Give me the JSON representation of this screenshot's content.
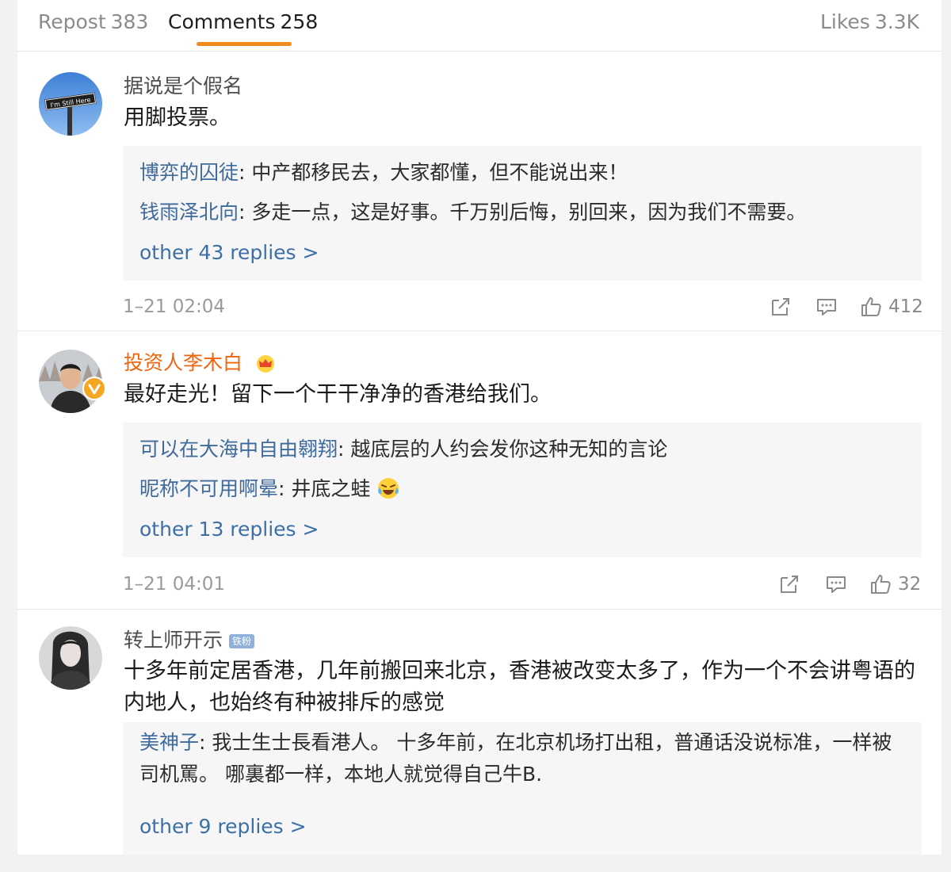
{
  "tabs": {
    "repost": {
      "label": "Repost",
      "count": "383"
    },
    "comments": {
      "label": "Comments",
      "count": "258"
    },
    "likes": {
      "label": "Likes",
      "count": "3.3K"
    }
  },
  "colors": {
    "accent": "#f28a1c",
    "link": "#3f6a9c",
    "vip_name": "#f0640e"
  },
  "comments": [
    {
      "user": "据说是个假名",
      "avatar_sign": "I'm Still Here",
      "text": "用脚投票。",
      "replies": [
        {
          "name": "博弈的囚徒",
          "text": ": 中产都移民去，大家都懂，但不能说出来！"
        },
        {
          "name": "钱雨泽北向",
          "text": ": 多走一点，这是好事。千万别后悔，别回来，因为我们不需要。"
        }
      ],
      "more": "other 43 replies >",
      "time": "1–21 02:04",
      "likes": "412",
      "icons": [
        "share-icon",
        "comment-icon",
        "thumbs-up-icon"
      ]
    },
    {
      "user": "投资人李木白",
      "badge": "crown-icon",
      "text": "最好走光！留下一个干干净净的香港给我们。",
      "replies": [
        {
          "name": "可以在大海中自由翱翔",
          "text": ": 越底层的人约会发你这种无知的言论"
        },
        {
          "name": "昵称不可用啊晕",
          "text": ": 井底之蛙"
        }
      ],
      "more": "other 13 replies >",
      "time": "1–21 04:01",
      "likes": "32",
      "icons": [
        "share-icon",
        "comment-icon",
        "thumbs-up-icon"
      ]
    },
    {
      "user": "转上师开示",
      "badge_text": "铁粉",
      "text": "十多年前定居香港，几年前搬回来北京，香港被改变太多了，作为一个不会讲粤语的内地人，也始终有种被排斥的感觉",
      "replies": [
        {
          "name": "美神子",
          "text": ": 我士生士長看港人。   十多年前，在北京机场打出租，普通话没说标准，一样被司机罵。   哪裏都一样，本地人就觉得自己牛B."
        }
      ],
      "more": "other 9 replies >"
    }
  ]
}
